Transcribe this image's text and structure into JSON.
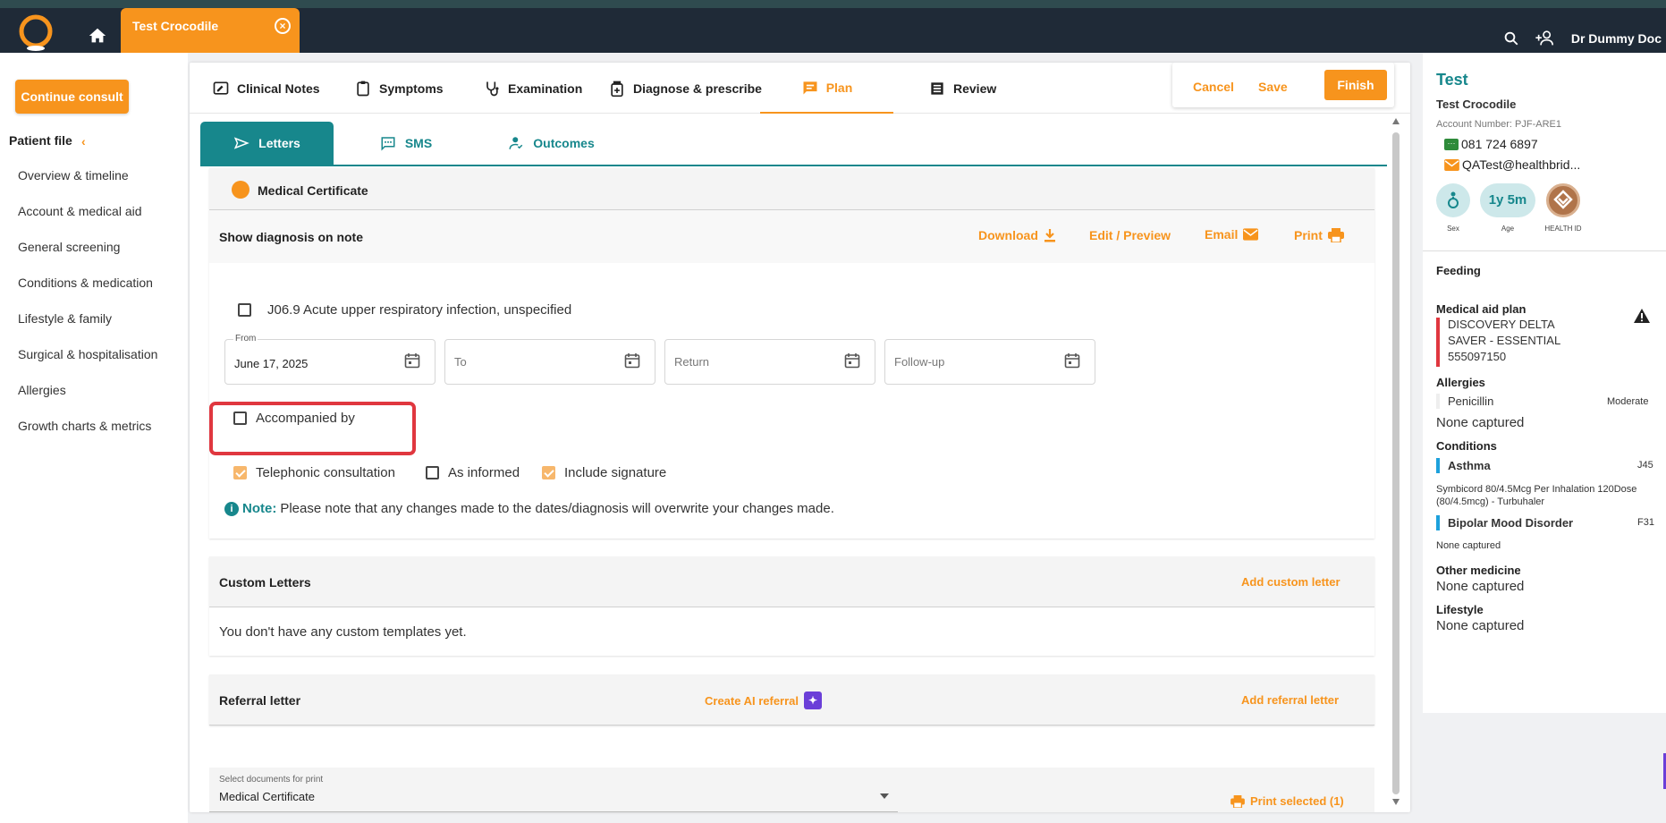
{
  "topbar": {
    "patient_tab": "Test Crocodile",
    "doctor": "Dr Dummy Doc"
  },
  "sidebar": {
    "continue_label": "Continue consult",
    "patient_file": "Patient file",
    "items": [
      "Overview & timeline",
      "Account & medical aid",
      "General screening",
      "Conditions & medication",
      "Lifestyle & family",
      "Surgical & hospitalisation",
      "Allergies",
      "Growth charts & metrics"
    ]
  },
  "tabs": {
    "clinical": "Clinical Notes",
    "symptoms": "Symptoms",
    "examination": "Examination",
    "diagnose": "Diagnose & prescribe",
    "plan": "Plan",
    "review": "Review"
  },
  "actions": {
    "cancel": "Cancel",
    "save": "Save",
    "finish": "Finish"
  },
  "subtabs": {
    "letters": "Letters",
    "sms": "SMS",
    "outcomes": "Outcomes"
  },
  "certificate": {
    "title": "Medical Certificate",
    "show_diagnosis": "Show diagnosis on note",
    "download": "Download",
    "edit_preview": "Edit / Preview",
    "email": "Email",
    "print": "Print",
    "diagnosis": "J06.9 Acute upper respiratory infection, unspecified",
    "from_label": "From",
    "from_value": "June 17, 2025",
    "to_placeholder": "To",
    "return_placeholder": "Return",
    "followup_placeholder": "Follow-up",
    "accompanied": "Accompanied by",
    "telephonic": "Telephonic consultation",
    "as_informed": "As informed",
    "include_signature": "Include signature",
    "note_label": "Note:",
    "note_text": "Please note that any changes made to the dates/diagnosis will overwrite your changes made."
  },
  "custom": {
    "title": "Custom Letters",
    "add": "Add custom letter",
    "empty": "You don't have any custom templates yet."
  },
  "referral": {
    "title": "Referral letter",
    "create_ai": "Create AI referral",
    "add": "Add referral letter"
  },
  "print_select": {
    "label": "Select documents for print",
    "value": "Medical Certificate",
    "print_selected": "Print selected (1)"
  },
  "patient": {
    "short_name": "Test",
    "full_name": "Test Crocodile",
    "account": "Account Number: PJF-ARE1",
    "phone": "081 724 6897",
    "email": "QATest@healthbrid...",
    "age": "1y 5m",
    "sex_label": "Sex",
    "age_label": "Age",
    "health_id_label": "HEALTH ID",
    "feeding": "Feeding",
    "medical_aid_title": "Medical aid plan",
    "medical_aid_line1": "DISCOVERY DELTA",
    "medical_aid_line2": "SAVER - ESSENTIAL",
    "medical_aid_number": "555097150",
    "allergies_title": "Allergies",
    "allergy_name": "Penicillin",
    "allergy_severity": "Moderate",
    "allergies_none": "None captured",
    "conditions_title": "Conditions",
    "cond1_name": "Asthma",
    "cond1_code": "J45",
    "cond1_med": "Symbicord 80/4.5Mcg Per Inhalation 120Dose (80/4.5mcg) - Turbuhaler",
    "cond2_name": "Bipolar Mood Disorder",
    "cond2_code": "F31",
    "cond2_med": "None captured",
    "other_title": "Other medicine",
    "other_value": "None captured",
    "lifestyle_title": "Lifestyle",
    "lifestyle_value": "None captured"
  },
  "colors": {
    "accent": "#f7941d",
    "teal": "#17878c",
    "highlight": "#e0373f"
  }
}
